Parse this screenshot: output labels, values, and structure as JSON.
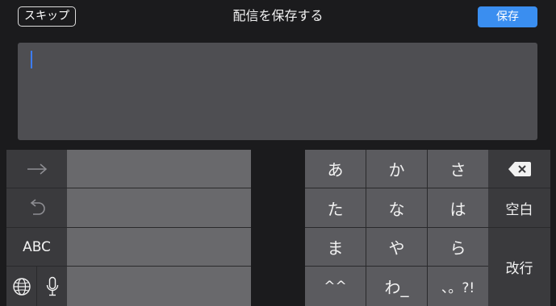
{
  "topbar": {
    "skip_label": "スキップ",
    "title": "配信を保存する",
    "save_label": "保存"
  },
  "text_area": {
    "value": ""
  },
  "keyboard": {
    "left_keys": {
      "abc_label": "ABC",
      "next_icon": "arrow-right-icon",
      "undo_icon": "undo-icon",
      "globe_icon": "globe-icon",
      "mic_icon": "microphone-icon"
    },
    "kana_keys": [
      [
        "あ",
        "か",
        "さ"
      ],
      [
        "た",
        "な",
        "は"
      ],
      [
        "ま",
        "や",
        "ら"
      ],
      [
        "^^",
        "わ_",
        "、。?!"
      ]
    ],
    "right_keys": {
      "delete_icon": "delete-icon",
      "space_label": "空白",
      "return_label": "改行"
    }
  },
  "colors": {
    "background": "#1b1b1d",
    "accent": "#3a8ef0",
    "caret": "#3d7cf5"
  }
}
